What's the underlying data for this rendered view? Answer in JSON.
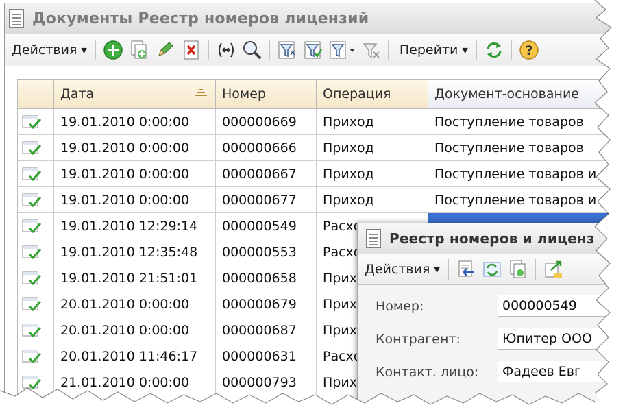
{
  "window": {
    "title": "Документы Реестр номеров лицензий"
  },
  "toolbar": {
    "actions_label": "Действия",
    "goto_label": "Перейти",
    "buttons": [
      "add-icon",
      "copy-icon",
      "edit-icon",
      "delete-icon",
      "range-icon",
      "find-icon",
      "filter-set-icon",
      "filter-icon",
      "filter-list-icon",
      "filter-clear-icon",
      "refresh-icon",
      "help-icon"
    ]
  },
  "table": {
    "columns": [
      "",
      "Дата",
      "Номер",
      "Операция",
      "Документ-основание"
    ],
    "rows": [
      {
        "date": "19.01.2010 0:00:00",
        "number": "000000669",
        "operation": "Приход",
        "basis": "Поступление товаров"
      },
      {
        "date": "19.01.2010 0:00:00",
        "number": "000000666",
        "operation": "Приход",
        "basis": "Поступление товаров"
      },
      {
        "date": "19.01.2010 0:00:00",
        "number": "000000667",
        "operation": "Приход",
        "basis": "Поступление товаров и у"
      },
      {
        "date": "19.01.2010 0:00:00",
        "number": "000000677",
        "operation": "Приход",
        "basis": "Поступление товаров и у"
      },
      {
        "date": "19.01.2010 12:29:14",
        "number": "000000549",
        "operation": "Расхо",
        "basis": ""
      },
      {
        "date": "19.01.2010 12:35:48",
        "number": "000000553",
        "operation": "Расхо",
        "basis": ""
      },
      {
        "date": "19.01.2010 21:51:01",
        "number": "000000658",
        "operation": "Прихо",
        "basis": ""
      },
      {
        "date": "20.01.2010 0:00:00",
        "number": "000000679",
        "operation": "Прихо",
        "basis": ""
      },
      {
        "date": "20.01.2010 0:00:00",
        "number": "000000687",
        "operation": "Прихо",
        "basis": ""
      },
      {
        "date": "20.01.2010 11:46:17",
        "number": "000000631",
        "operation": "Расхо",
        "basis": ""
      },
      {
        "date": "21.01.2010 0:00:00",
        "number": "000000793",
        "operation": "Прихо",
        "basis": ""
      }
    ]
  },
  "dialog": {
    "title": "Реестр номеров и лиценз",
    "actions_label": "Действия",
    "fields": [
      {
        "label": "Номер:",
        "value": "000000549"
      },
      {
        "label": "Контрагент:",
        "value": "Юпитер ООО"
      },
      {
        "label": "Контакт. лицо:",
        "value": "Фадеев Евг"
      }
    ]
  },
  "colors": {
    "header_bg": "#f4e7c8",
    "selection": "#3b6fd1",
    "check_green": "#2fa52f"
  }
}
